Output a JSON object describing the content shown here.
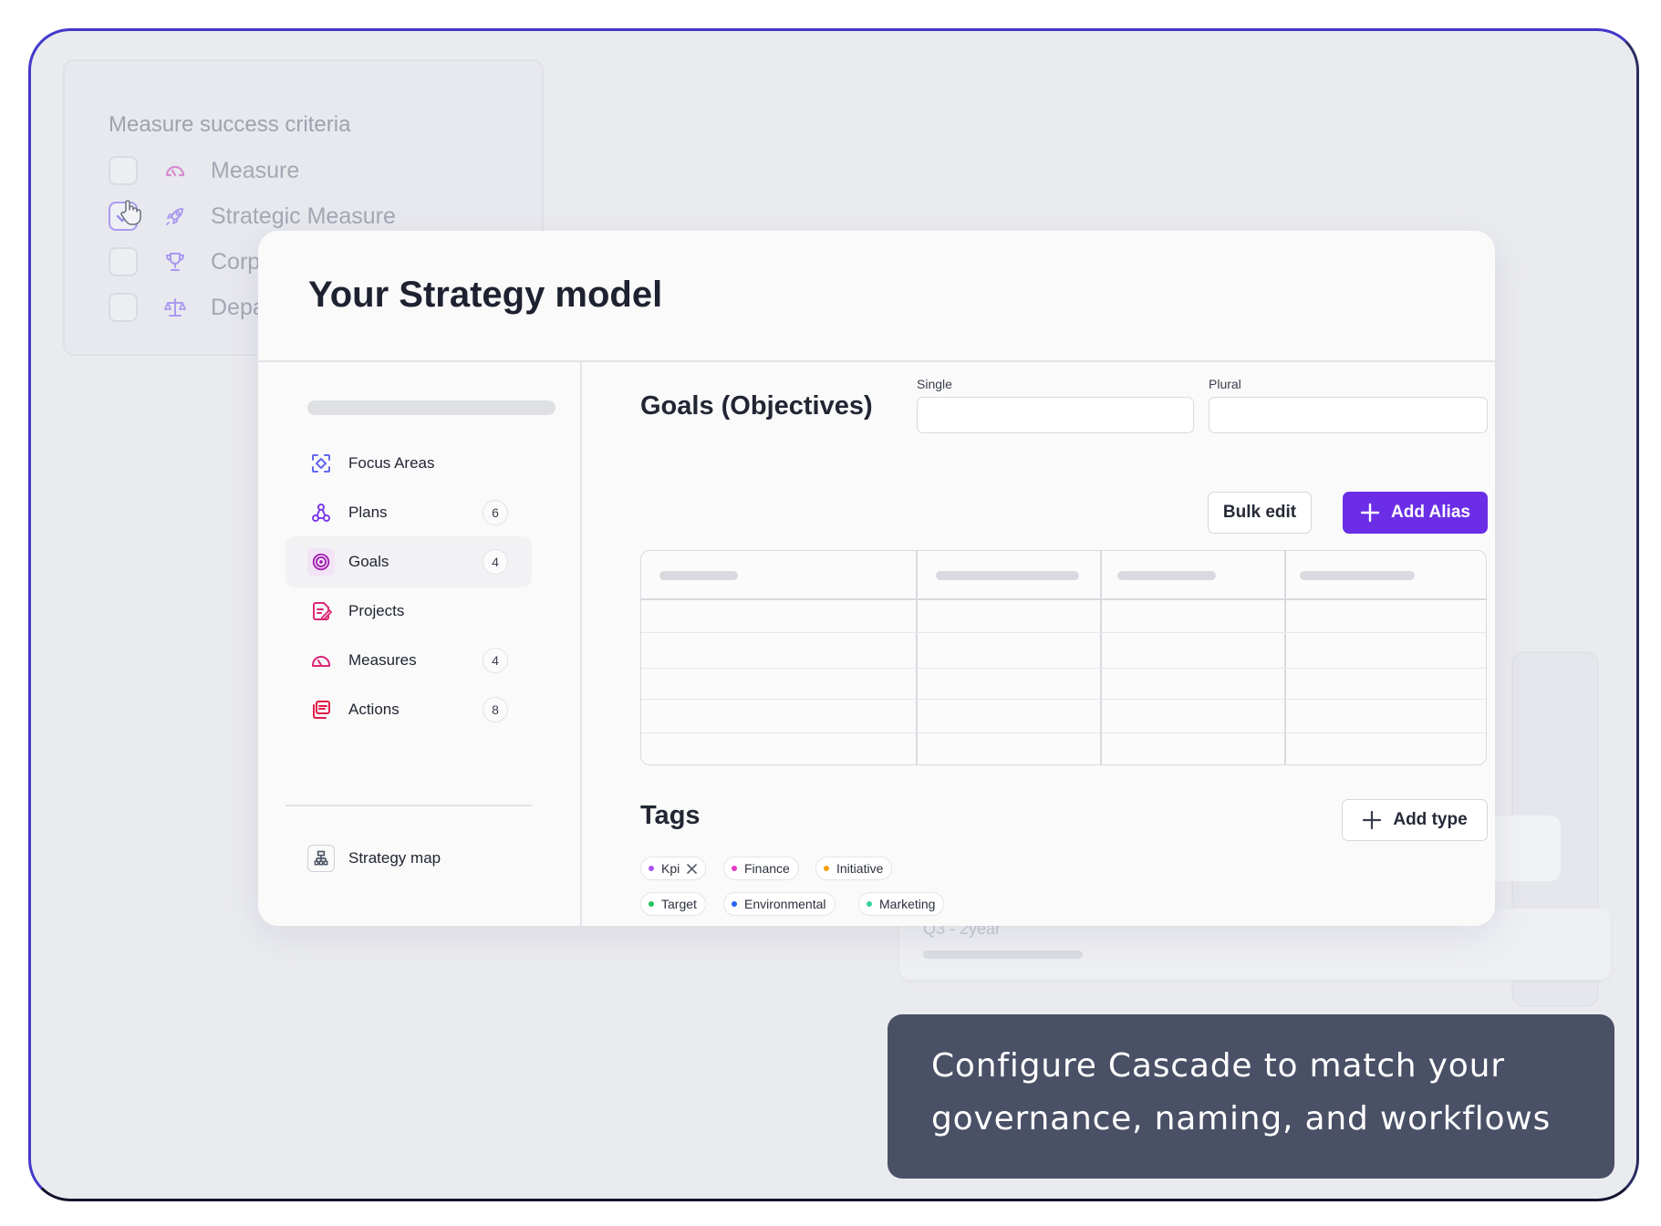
{
  "background": {
    "card_title": "Measure success criteria",
    "items": [
      {
        "label": "Measure",
        "checked": false,
        "icon": "gauge-icon"
      },
      {
        "label": "Strategic Measure",
        "checked": true,
        "icon": "rocket-icon"
      },
      {
        "label": "Corp",
        "checked": false,
        "icon": "trophy-icon"
      },
      {
        "label": "Depa",
        "checked": false,
        "icon": "scales-icon"
      }
    ],
    "card_bottom_text": "Q3 - 2year"
  },
  "modal": {
    "title": "Your Strategy model",
    "nav": [
      {
        "label": "Focus Areas",
        "count": null,
        "icon": "focus-icon",
        "color": "#6366f1"
      },
      {
        "label": "Plans",
        "count": "6",
        "icon": "plans-icon",
        "color": "#7c3aed"
      },
      {
        "label": "Goals",
        "count": "4",
        "icon": "target-icon",
        "color": "#a21caf",
        "active": true
      },
      {
        "label": "Projects",
        "count": null,
        "icon": "projects-icon",
        "color": "#db2777"
      },
      {
        "label": "Measures",
        "count": "4",
        "icon": "gauge-icon",
        "color": "#db2777"
      },
      {
        "label": "Actions",
        "count": "8",
        "icon": "actions-icon",
        "color": "#e11d48"
      },
      {
        "label": "Strategy map",
        "count": null,
        "icon": "strategy-map-icon",
        "color": "#4b5563"
      }
    ],
    "section_title": "Goals (Objectives)",
    "single_label": "Single",
    "plural_label": "Plural",
    "single_value": "",
    "plural_value": "",
    "bulk_edit_label": "Bulk edit",
    "add_alias_label": "Add Alias",
    "tags_title": "Tags",
    "add_type_label": "Add type",
    "tags": [
      {
        "label": "Kpi",
        "color": "#a855f7",
        "removable": true
      },
      {
        "label": "Finance",
        "color": "#e639c8"
      },
      {
        "label": "Initiative",
        "color": "#f59e0b"
      },
      {
        "label": "Target",
        "color": "#22c55e"
      },
      {
        "label": "Environmental",
        "color": "#2563eb"
      },
      {
        "label": "Marketing",
        "color": "#34d399"
      }
    ],
    "accent_color": "#6b2ee6"
  },
  "callout": {
    "line1": "Configure Cascade to match your",
    "line2": "governance, naming, and workflows"
  }
}
